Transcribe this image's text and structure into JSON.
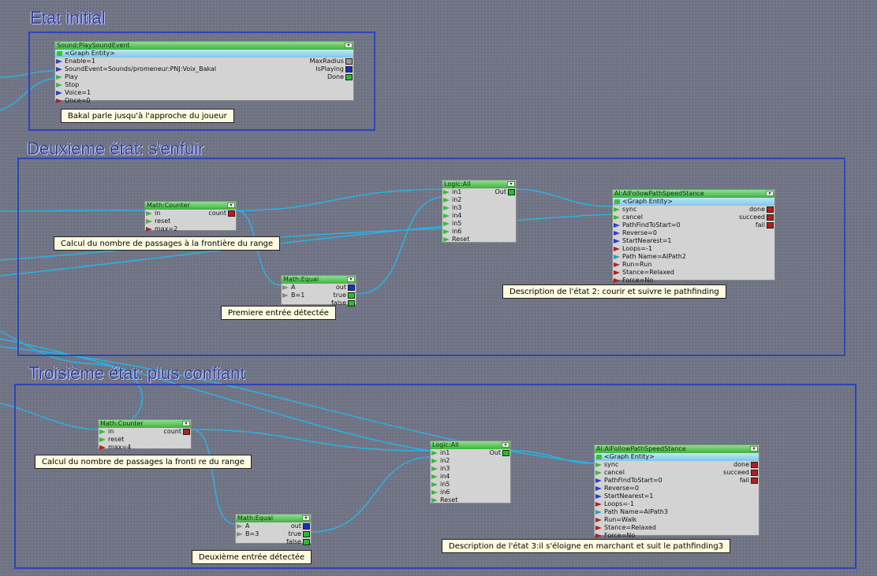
{
  "states": {
    "s1": {
      "title": "Etat initial"
    },
    "s2": {
      "title": "Deuxieme état: s'enfuir"
    },
    "s3": {
      "title": "Troisième état: plus confiant"
    }
  },
  "nodes": {
    "sound": {
      "title": "Sound:PlaySoundEvent",
      "entity": "<Graph Entity>",
      "ports": [
        "Enable=1",
        "SoundEvent=Sounds/promeneur:PNJ:Voix_Bakal",
        "Play",
        "Stop",
        "Voice=1",
        "Once=0"
      ],
      "outputs": [
        "MaxRadius",
        "IsPlaying",
        "Done"
      ]
    },
    "counter1": {
      "title": "Math:Counter",
      "ports": [
        "in",
        "reset",
        "max=2"
      ],
      "outputs": [
        "count"
      ]
    },
    "equal1": {
      "title": "Math:Equal",
      "ports": [
        "A",
        "B=1"
      ],
      "outputs": [
        "out",
        "true",
        "false"
      ]
    },
    "logic1": {
      "title": "Logic:All",
      "ports": [
        "in1",
        "in2",
        "in3",
        "in4",
        "in5",
        "in6",
        "Reset"
      ],
      "outputs": [
        "Out"
      ]
    },
    "ai1": {
      "title": "AI:AIFollowPathSpeedStance",
      "entity": "<Graph Entity>",
      "ports": [
        "sync",
        "cancel",
        "PathFindToStart=0",
        "Reverse=0",
        "StartNearest=1",
        "Loops=-1",
        "Path Name=AIPath2",
        "Run=Run",
        "Stance=Relaxed",
        "Force=No"
      ],
      "outputs": [
        "done",
        "succeed",
        "fail"
      ]
    },
    "counter2": {
      "title": "Math:Counter",
      "ports": [
        "in",
        "reset",
        "max=4"
      ],
      "outputs": [
        "count"
      ]
    },
    "equal2": {
      "title": "Math:Equal",
      "ports": [
        "A",
        "B=3"
      ],
      "outputs": [
        "out",
        "true",
        "false"
      ]
    },
    "logic2": {
      "title": "Logic:All",
      "ports": [
        "in1",
        "in2",
        "in3",
        "in4",
        "in5",
        "in6",
        "Reset"
      ],
      "outputs": [
        "Out"
      ]
    },
    "ai2": {
      "title": "AI:AIFollowPathSpeedStance",
      "entity": "<Graph Entity>",
      "ports": [
        "sync",
        "cancel",
        "PathFindToStart=0",
        "Reverse=0",
        "StartNearest=1",
        "Loops=-1",
        "Path Name=AIPath3",
        "Run=Walk",
        "Stance=Relaxed",
        "Force=No"
      ],
      "outputs": [
        "done",
        "succeed",
        "fail"
      ]
    }
  },
  "comments": {
    "c1": "Bakal parle jusqu'à l'approche du joueur",
    "c2": "Calcul du nombre de passages à la frontière du range",
    "c3": "Premiere entrée détectée",
    "c4": "Description de l'état 2: courir et suivre le pathfinding",
    "c5": "Calcul du nombre de passages la fronti re du range",
    "c6": "Deuxième entrée détectée",
    "c7": "Description de l'état 3:il s'éloigne en marchant et suit le pathfinding3"
  },
  "colors": {
    "background": "#6e7182",
    "group_border": "#2a47b8",
    "title_text": "#2f3f9e",
    "link": "#28b4e6",
    "node_header": "#3fb13f",
    "entity_row": "#7fc7e6",
    "comment_bg": "#fffbe0"
  }
}
